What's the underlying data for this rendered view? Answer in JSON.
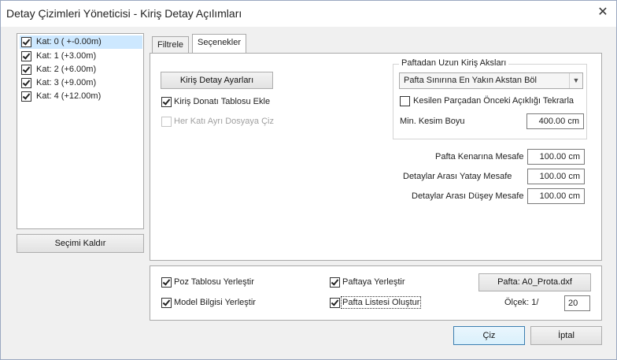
{
  "window": {
    "title": "Detay Çizimleri Yöneticisi  - Kiriş Detay Açılımları",
    "close_glyph": "✕"
  },
  "floors": [
    {
      "label": "Kat: 0 ( +-0.00m)",
      "checked": true
    },
    {
      "label": "Kat: 1 (+3.00m)",
      "checked": true
    },
    {
      "label": "Kat: 2 (+6.00m)",
      "checked": true
    },
    {
      "label": "Kat: 3 (+9.00m)",
      "checked": true
    },
    {
      "label": "Kat: 4 (+12.00m)",
      "checked": true
    }
  ],
  "clear_selection_label": "Seçimi Kaldır",
  "tabs": [
    {
      "label": "Filtrele"
    },
    {
      "label": "Seçenekler"
    }
  ],
  "options": {
    "beam_settings_label": "Kiriş Detay Ayarları",
    "add_rebar_table_label": "Kiriş Donatı Tablosu Ekle",
    "separate_files_label": "Her Katı Ayrı Dosyaya Çiz",
    "long_beams_group_title": "Paftadan Uzun Kiriş Aksları",
    "split_mode_value": "Pafta Sınırına En Yakın Akstan Böl",
    "repeat_span_label": "Kesilen Parçadan Önceki Açıklığı Tekrarla",
    "min_cut_length_label": "Min. Kesim Boyu",
    "min_cut_length_value": "400.00 cm",
    "sheet_margin_label": "Pafta Kenarına Mesafe",
    "sheet_margin_value": "100.00 cm",
    "horizontal_gap_label": "Detaylar Arası Yatay Mesafe",
    "horizontal_gap_value": "100.00 cm",
    "vertical_gap_label": "Detaylar Arası Düşey Mesafe",
    "vertical_gap_value": "100.00 cm"
  },
  "bottom": {
    "place_pos_table_label": "Poz Tablosu Yerleştir",
    "place_model_info_label": "Model Bilgisi Yerleştir",
    "place_on_sheet_label": "Paftaya Yerleştir",
    "create_sheet_list_label": "Pafta Listesi Oluştur",
    "sheet_file_button_label": "Pafta: A0_Prota.dxf",
    "scale_label": "Ölçek: 1/",
    "scale_value": "20"
  },
  "actions": {
    "draw_label": "Çiz",
    "cancel_label": "İptal"
  }
}
